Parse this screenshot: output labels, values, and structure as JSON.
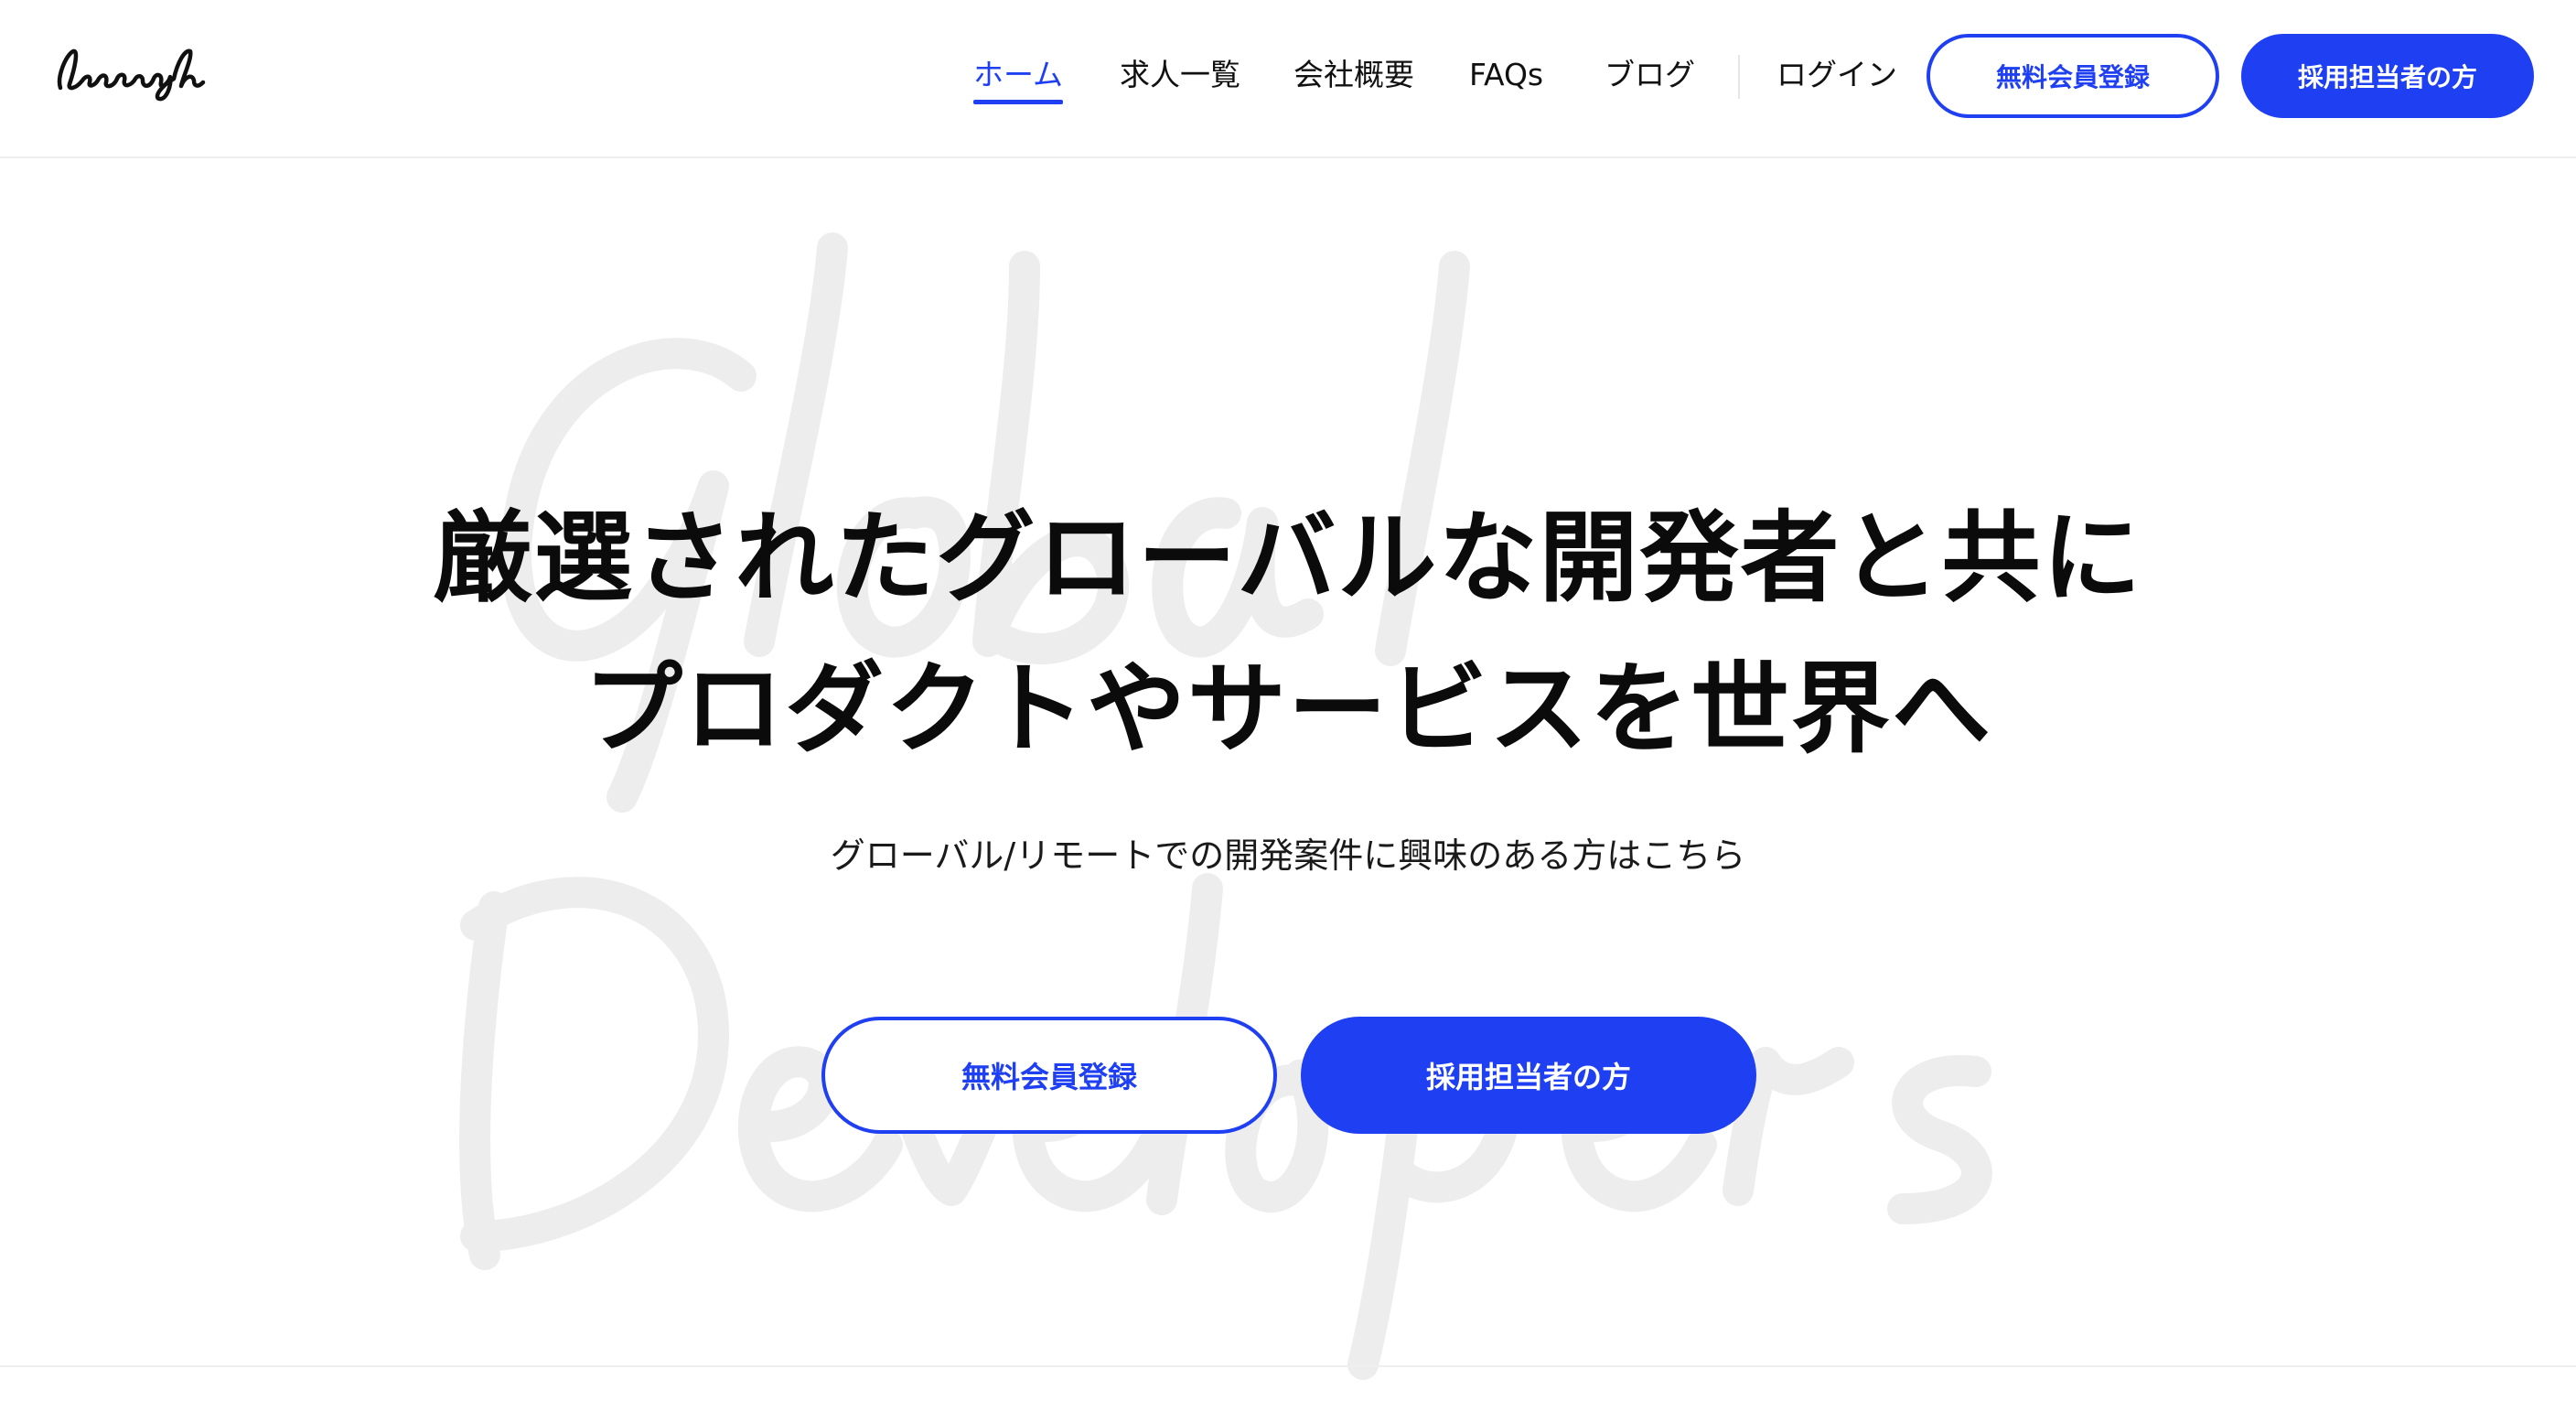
{
  "header": {
    "logo_text": "Inaough",
    "nav": [
      {
        "label": "ホーム",
        "active": true
      },
      {
        "label": "求人一覧",
        "active": false
      },
      {
        "label": "会社概要",
        "active": false
      },
      {
        "label": "FAQs",
        "active": false
      },
      {
        "label": "ブログ",
        "active": false
      }
    ],
    "login_label": "ログイン",
    "register_label": "無料会員登録",
    "employer_label": "採用担当者の方"
  },
  "hero": {
    "background_script": [
      "Global",
      "Developers"
    ],
    "headline_line1": "厳選されたグローバルな開発者と共に",
    "headline_line2": "プロダクトやサービスを世界へ",
    "subheadline": "グローバル/リモートでの開発案件に興味のある方はこちら",
    "cta_register_label": "無料会員登録",
    "cta_employer_label": "採用担当者の方"
  },
  "colors": {
    "accent": "#1f3ff2",
    "text": "#0b0b0b",
    "background": "#ffffff",
    "script_watermark": "#ededed"
  }
}
